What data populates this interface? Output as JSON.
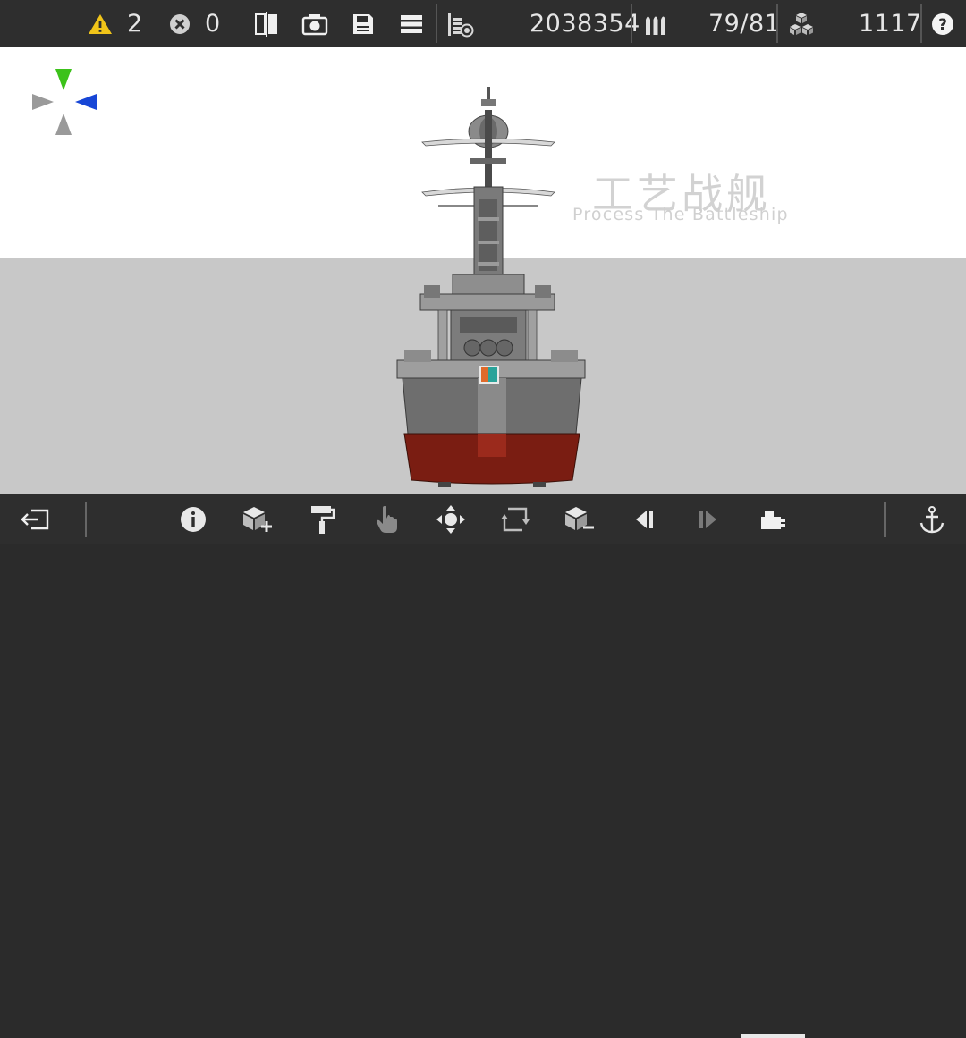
{
  "topbar": {
    "warnings": "2",
    "errors": "0",
    "cost": "2038354",
    "ammo": "79/81",
    "parts": "1117"
  },
  "watermark": {
    "title_cn": "工艺战舰",
    "title_en": "Process The Battleship"
  },
  "colors": {
    "warning": "#f0c419",
    "bar_bg": "#2e2e2e",
    "hull_grey": "#6e6e6e",
    "hull_red": "#7a1d12",
    "axis_green": "#3cc21a",
    "axis_blue": "#1746d6"
  },
  "icons": {
    "top": [
      "warning-icon",
      "error-icon",
      "mirror-icon",
      "camera-icon",
      "save-icon",
      "menu-icon",
      "cost-icon",
      "ammo-icon",
      "parts-icon",
      "help-icon"
    ],
    "bottom": [
      "exit-icon",
      "info-icon",
      "add-part-icon",
      "paint-roller-icon",
      "hand-icon",
      "move-icon",
      "rotate-icon",
      "remove-part-icon",
      "prev-icon",
      "next-icon",
      "turret-icon",
      "anchor-icon"
    ]
  }
}
